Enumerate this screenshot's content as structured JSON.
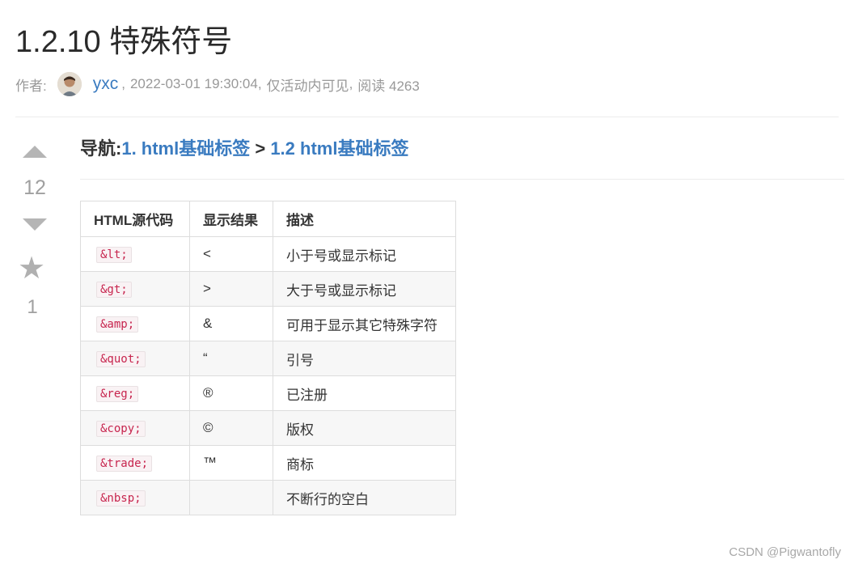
{
  "article": {
    "title": "1.2.10 特殊符号",
    "author_label": "作者:",
    "author": "yxc",
    "sep1": ",",
    "datetime": "2022-03-01 19:30:04",
    "sep2": ",",
    "visibility": "仅活动内可见",
    "sep3": ",",
    "reads": "阅读 4263"
  },
  "votes": {
    "up_icon": "triangle-up-icon",
    "count": "12",
    "down_icon": "triangle-down-icon",
    "star_icon": "star-icon",
    "star_count": "1"
  },
  "nav": {
    "label": "导航:",
    "link1": "1. html基础标签",
    "separator": " > ",
    "link2": "1.2 html基础标签"
  },
  "table": {
    "headers": [
      "HTML源代码",
      "显示结果",
      "描述"
    ],
    "rows": [
      {
        "code": "&lt;",
        "result": "<",
        "desc": "小于号或显示标记"
      },
      {
        "code": "&gt;",
        "result": ">",
        "desc": "大于号或显示标记"
      },
      {
        "code": "&amp;",
        "result": "&",
        "desc": "可用于显示其它特殊字符"
      },
      {
        "code": "&quot;",
        "result": "“",
        "desc": "引号"
      },
      {
        "code": "&reg;",
        "result": "®",
        "desc": "已注册"
      },
      {
        "code": "&copy;",
        "result": "©",
        "desc": "版权"
      },
      {
        "code": "&trade;",
        "result": "™",
        "desc": "商标"
      },
      {
        "code": "&nbsp;",
        "result": "",
        "desc": "不断行的空白"
      }
    ]
  },
  "watermark": "CSDN @Pigwantofly",
  "colors": {
    "link": "#3a7bc0",
    "code_text": "#c7254e",
    "muted": "#999999"
  }
}
